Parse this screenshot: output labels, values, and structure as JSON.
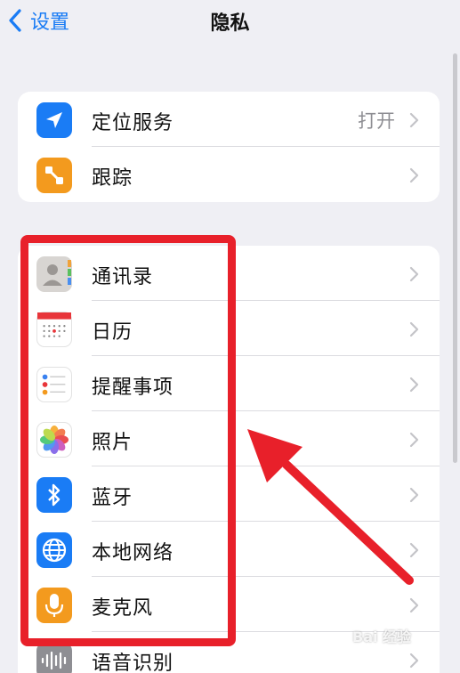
{
  "nav": {
    "back_label": "设置",
    "title": "隐私"
  },
  "group1": [
    {
      "label": "定位服务",
      "value": "打开",
      "icon": "location-icon"
    },
    {
      "label": "跟踪",
      "value": "",
      "icon": "tracking-icon"
    }
  ],
  "group2": [
    {
      "label": "通讯录",
      "icon": "contacts-icon"
    },
    {
      "label": "日历",
      "icon": "calendar-icon"
    },
    {
      "label": "提醒事项",
      "icon": "reminders-icon"
    },
    {
      "label": "照片",
      "icon": "photos-icon"
    },
    {
      "label": "蓝牙",
      "icon": "bluetooth-icon"
    },
    {
      "label": "本地网络",
      "icon": "local-network-icon"
    },
    {
      "label": "麦克风",
      "icon": "microphone-icon"
    },
    {
      "label": "语音识别",
      "icon": "speech-recognition-icon"
    }
  ],
  "watermark": {
    "text": "Bai 经验"
  },
  "colors": {
    "accent": "#1a7cf5",
    "highlight": "#e8202a",
    "background": "#efeff4"
  }
}
